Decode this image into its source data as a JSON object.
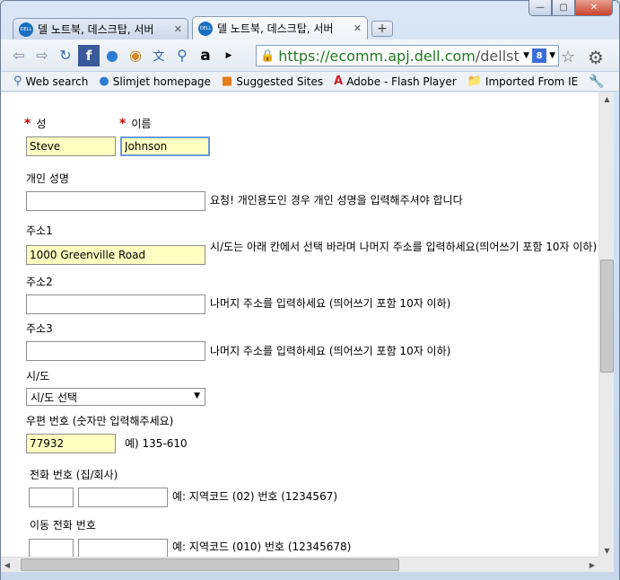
{
  "browser": {
    "tabs": [
      {
        "label": "델 노트북, 데스크탑, 서버",
        "favicon": "DELL"
      },
      {
        "label": "델 노트북, 데스크탑, 서버",
        "favicon": "DELL"
      }
    ],
    "url_secure": "https://ecomm.apj.dell.com",
    "url_rest": "/dellstore/m",
    "bookmarks": [
      {
        "label": "Web search",
        "icon": "search-icon"
      },
      {
        "label": "Slimjet homepage",
        "icon": "globe-icon"
      },
      {
        "label": "Suggested Sites",
        "icon": "suggested-sites-icon"
      },
      {
        "label": "Adobe - Flash Player",
        "icon": "adobe-icon"
      },
      {
        "label": "Imported From IE",
        "icon": "folder-icon"
      }
    ]
  },
  "form": {
    "last_name_label": "성",
    "first_name_label": "이름",
    "last_name_value": "Steve",
    "first_name_value": "Johnson",
    "personal_name_label": "개인 성명",
    "personal_name_note": "요청! 개인용도인 경우 개인 성명을 입력해주셔야 합니다",
    "address1_label": "주소1",
    "address1_value": "1000 Greenville Road",
    "address1_note": "시/도는 아래 칸에서 선택 바라며 나머지 주소를 입력하세요(띄어쓰기 포함 10자 이하)",
    "address2_label": "주소2",
    "address2_note": "나머지 주소를 입력하세요 (띄어쓰기 포함 10자 이하)",
    "address3_label": "주소3",
    "address3_note": "나머지 주소를 입력하세요 (띄어쓰기 포함 10자 이하)",
    "province_label": "시/도",
    "province_selected": "시/도 선택",
    "postal_label": "우편 번호 (숫자만 입력해주세요)",
    "postal_value": "77932",
    "postal_example": "예) 135-610",
    "phone_label": "전화 번호 (집/회사)",
    "phone_example": "예: 지역코드 (02) 번호 (1234567)",
    "mobile_label": "이동 전화 번호",
    "mobile_example": "예: 지역코드 (010) 번호 (12345678)"
  }
}
